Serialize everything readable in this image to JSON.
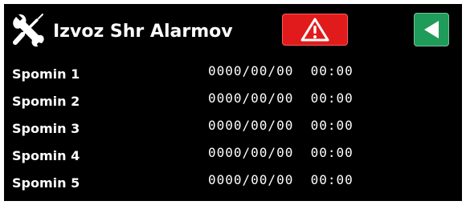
{
  "header": {
    "title": "Izvoz Shr Alarmov",
    "tools_icon": "wrench-screwdriver-icon",
    "alarm_icon": "warning-triangle-icon",
    "back_icon": "back-arrow-icon"
  },
  "colors": {
    "background": "#000000",
    "text": "#ffffff",
    "alarm_button": "#e11b1b",
    "back_button": "#1f9b5a"
  },
  "alarms": [
    {
      "label": "Spomin 1",
      "datetime": "0000/00/00  00:00"
    },
    {
      "label": "Spomin 2",
      "datetime": "0000/00/00  00:00"
    },
    {
      "label": "Spomin 3",
      "datetime": "0000/00/00  00:00"
    },
    {
      "label": "Spomin 4",
      "datetime": "0000/00/00  00:00"
    },
    {
      "label": "Spomin 5",
      "datetime": "0000/00/00  00:00"
    }
  ]
}
